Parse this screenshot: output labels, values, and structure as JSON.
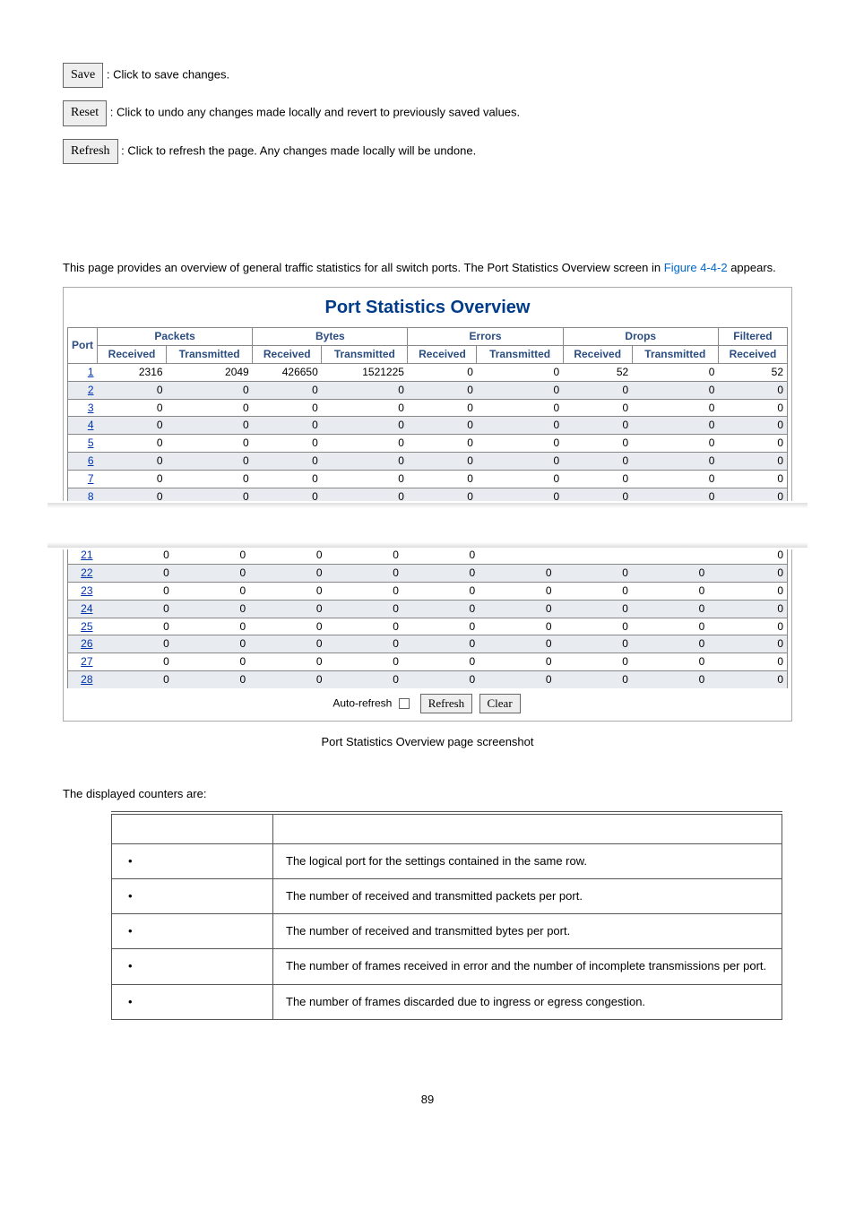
{
  "buttons": {
    "save": {
      "label": "Save",
      "desc": ": Click to save changes."
    },
    "reset": {
      "label": "Reset",
      "desc": ": Click to undo any changes made locally and revert to previously saved values."
    },
    "refresh": {
      "label": "Refresh",
      "desc": ": Click to refresh the page. Any changes made locally will be undone."
    }
  },
  "intro": {
    "text_before_link": "This page provides an overview of general traffic statistics for all switch ports. The Port Statistics Overview screen in ",
    "figure_ref": "Figure 4-4-2",
    "text_after_link": " appears."
  },
  "screenshot": {
    "title": "Port Statistics Overview",
    "header": {
      "port": "Port",
      "groups": [
        "Packets",
        "Bytes",
        "Errors",
        "Drops",
        "Filtered"
      ],
      "sub": [
        "Received",
        "Transmitted"
      ],
      "filtered_sub": "Received"
    },
    "rows_top": [
      {
        "port": "1",
        "cells": [
          "2316",
          "2049",
          "426650",
          "1521225",
          "0",
          "0",
          "52",
          "0",
          "52"
        ]
      },
      {
        "port": "2",
        "cells": [
          "0",
          "0",
          "0",
          "0",
          "0",
          "0",
          "0",
          "0",
          "0"
        ]
      },
      {
        "port": "3",
        "cells": [
          "0",
          "0",
          "0",
          "0",
          "0",
          "0",
          "0",
          "0",
          "0"
        ]
      },
      {
        "port": "4",
        "cells": [
          "0",
          "0",
          "0",
          "0",
          "0",
          "0",
          "0",
          "0",
          "0"
        ]
      },
      {
        "port": "5",
        "cells": [
          "0",
          "0",
          "0",
          "0",
          "0",
          "0",
          "0",
          "0",
          "0"
        ]
      },
      {
        "port": "6",
        "cells": [
          "0",
          "0",
          "0",
          "0",
          "0",
          "0",
          "0",
          "0",
          "0"
        ]
      },
      {
        "port": "7",
        "cells": [
          "0",
          "0",
          "0",
          "0",
          "0",
          "0",
          "0",
          "0",
          "0"
        ]
      },
      {
        "port": "8",
        "cells": [
          "0",
          "0",
          "0",
          "0",
          "0",
          "0",
          "0",
          "0",
          "0"
        ]
      }
    ],
    "rows_bottom": [
      {
        "port": "21",
        "cells": [
          "0",
          "0",
          "0",
          "0",
          "0",
          "",
          "",
          "",
          "0"
        ]
      },
      {
        "port": "22",
        "cells": [
          "0",
          "0",
          "0",
          "0",
          "0",
          "0",
          "0",
          "0",
          "0"
        ]
      },
      {
        "port": "23",
        "cells": [
          "0",
          "0",
          "0",
          "0",
          "0",
          "0",
          "0",
          "0",
          "0"
        ]
      },
      {
        "port": "24",
        "cells": [
          "0",
          "0",
          "0",
          "0",
          "0",
          "0",
          "0",
          "0",
          "0"
        ]
      },
      {
        "port": "25",
        "cells": [
          "0",
          "0",
          "0",
          "0",
          "0",
          "0",
          "0",
          "0",
          "0"
        ]
      },
      {
        "port": "26",
        "cells": [
          "0",
          "0",
          "0",
          "0",
          "0",
          "0",
          "0",
          "0",
          "0"
        ]
      },
      {
        "port": "27",
        "cells": [
          "0",
          "0",
          "0",
          "0",
          "0",
          "0",
          "0",
          "0",
          "0"
        ]
      },
      {
        "port": "28",
        "cells": [
          "0",
          "0",
          "0",
          "0",
          "0",
          "0",
          "0",
          "0",
          "0"
        ]
      }
    ],
    "controls": {
      "auto_refresh": "Auto-refresh",
      "refresh": "Refresh",
      "clear": "Clear"
    },
    "caption": "Port Statistics Overview page screenshot"
  },
  "counters": {
    "heading": "The displayed counters are:",
    "rows": [
      {
        "desc": "The logical port for the settings contained in the same row."
      },
      {
        "desc": "The number of received and transmitted packets per port."
      },
      {
        "desc": "The number of received and transmitted bytes per port."
      },
      {
        "desc": "The number of frames received in error and the number of incomplete transmissions per port."
      },
      {
        "desc": "The number of frames discarded due to ingress or egress congestion."
      }
    ]
  },
  "page_number": "89"
}
